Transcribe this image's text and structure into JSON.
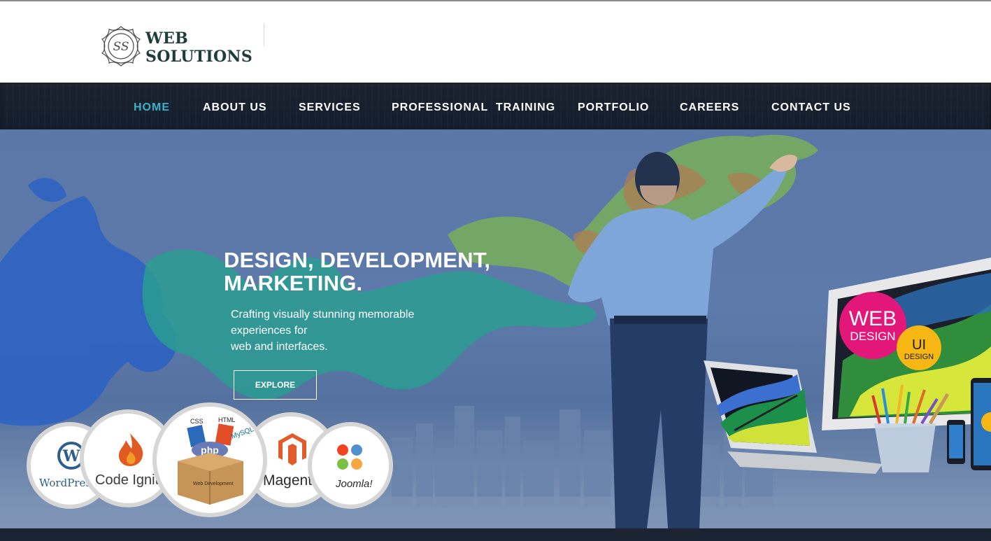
{
  "header": {
    "logo_monogram": "SS",
    "logo_line1": "WEB",
    "logo_line2": "SOLUTIONS"
  },
  "nav": {
    "items": [
      {
        "label": "HOME",
        "active": true
      },
      {
        "label": "ABOUT US",
        "active": false
      },
      {
        "label": "SERVICES",
        "active": false
      },
      {
        "label": "PROFESSIONAL  TRAINING",
        "active": false
      },
      {
        "label": "PORTFOLIO",
        "active": false
      },
      {
        "label": "CAREERS",
        "active": false
      },
      {
        "label": "CONTACT US",
        "active": false
      }
    ]
  },
  "hero": {
    "title_line1": "DESIGN, DEVELOPMENT,",
    "title_line2": "MARKETING.",
    "subtitle_line1": "Crafting visually stunning memorable",
    "subtitle_line2": "experiences for",
    "subtitle_line3": "web and interfaces.",
    "explore_label": "EXPLORE"
  },
  "tech_logos": {
    "wordpress": "WordPress",
    "codeigniter": "Code Igniter",
    "webdev_box": "Web Development",
    "webdev_php": "php",
    "webdev_css": "CSS",
    "webdev_html": "HTML",
    "webdev_mysql": "MySQL",
    "magento": "Magento",
    "joomla": "Joomla!"
  },
  "devices": {
    "badge_web_line1": "WEB",
    "badge_web_line2": "DESIGN",
    "badge_ui_line1": "UI",
    "badge_ui_line2": "DESIGN"
  },
  "colors": {
    "nav_active": "#3ab1c8",
    "logo_text": "#1e3d39",
    "hero_bg": "#5b77a8",
    "badge_web": "#e3167a",
    "badge_ui": "#f6b714"
  }
}
